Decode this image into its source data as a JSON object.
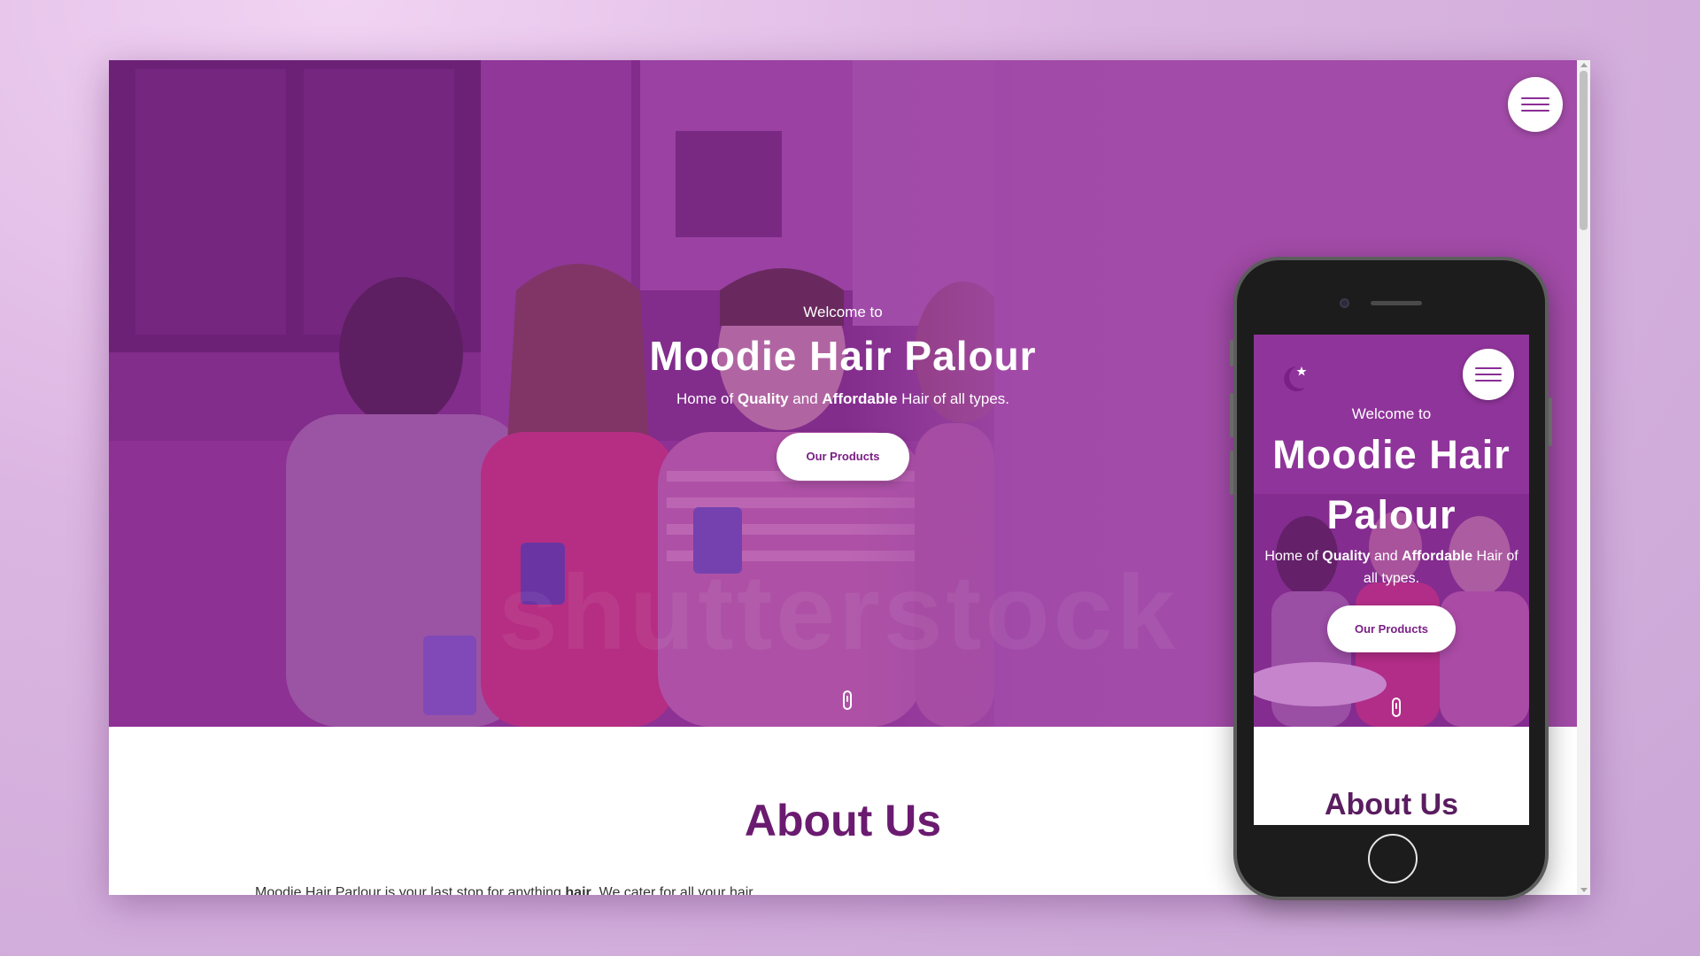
{
  "site": {
    "welcome": "Welcome to",
    "title": "Moodie Hair Palour",
    "mobile_title_line1": "Moodie Hair",
    "mobile_title_line2": "Palour",
    "tagline": {
      "pre": "Home of",
      "quality": "Quality",
      "and": "and",
      "affordable": "Affordable",
      "post": "Hair of all types."
    },
    "products_button": "Our Products",
    "about_heading": "About Us",
    "about_text_pre": "Moodie Hair Parlour is your last stop for anything",
    "about_text_bold": "hair",
    "about_text_post": ". We cater for all your hair"
  },
  "icons": {
    "menu": "hamburger-menu-icon",
    "scroll": "scroll-mouse-icon",
    "logo": "moodie-logo"
  },
  "colors": {
    "brand_purple": "#a24ba8",
    "heading_purple": "#6a1b70",
    "button_text": "#7a1f85",
    "background": "#dcb6e2"
  }
}
